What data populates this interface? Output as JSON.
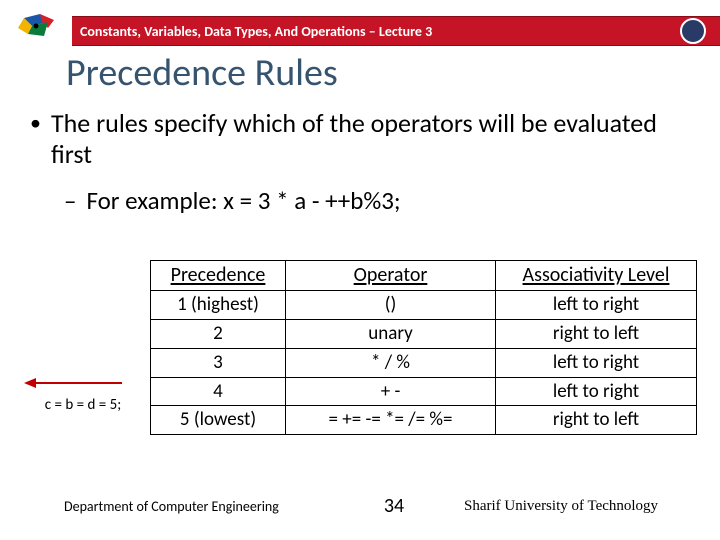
{
  "header": {
    "lecture_label": "Constants, Variables, Data Types, And Operations – Lecture 3"
  },
  "title": "Precedence Rules",
  "bullets": {
    "main": "The rules specify which of the operators will be evaluated first",
    "sub": "For example: x = 3 * a - ++b%3;"
  },
  "side_note": "c = b = d = 5;",
  "table": {
    "headers": {
      "c1": "Precedence",
      "c2": "Operator",
      "c3": "Associativity Level"
    },
    "rows": [
      {
        "prec": "1 (highest)",
        "op": "()",
        "assoc": "left to right"
      },
      {
        "prec": "2",
        "op": "unary",
        "assoc": "right to left"
      },
      {
        "prec": "3",
        "op": "*   /   %",
        "assoc": "left to right"
      },
      {
        "prec": "4",
        "op": "+   -",
        "assoc": "left to right"
      },
      {
        "prec": "5 (lowest)",
        "op": "=   +=   -=   *=   /=   %=",
        "assoc": "right to left"
      }
    ]
  },
  "footer": {
    "dept": "Department of Computer Engineering",
    "page": "34",
    "uni": "Sharif University of Technology"
  }
}
